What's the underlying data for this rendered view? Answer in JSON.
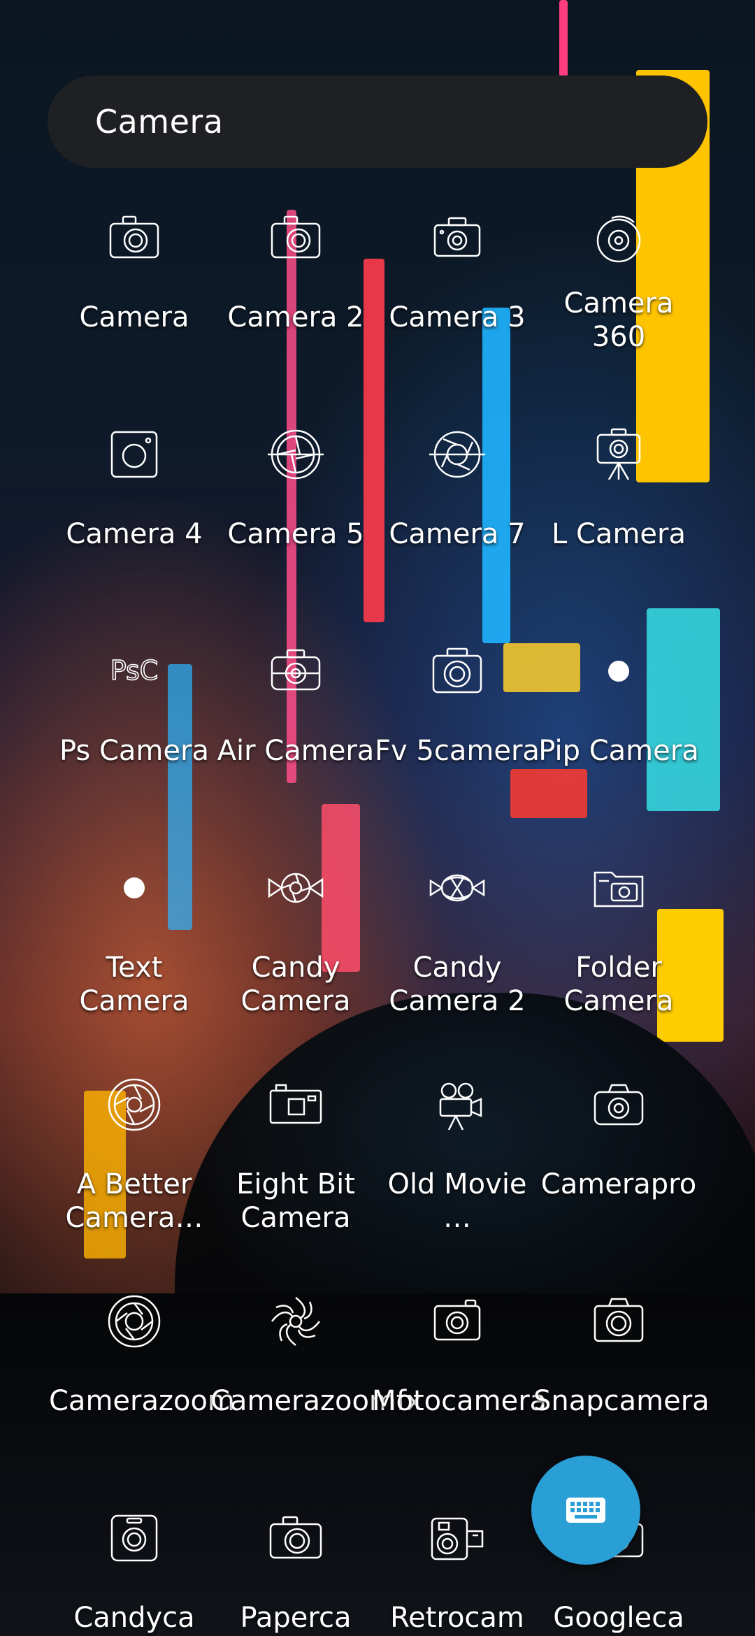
{
  "search": {
    "query": "Camera"
  },
  "apps": [
    {
      "label": "Camera",
      "icon": "camera-icon"
    },
    {
      "label": "Camera 2",
      "icon": "camera-icon"
    },
    {
      "label": "Camera 3",
      "icon": "camera-icon"
    },
    {
      "label": "Camera 360",
      "icon": "camera-360-icon"
    },
    {
      "label": "Camera 4",
      "icon": "camera-square-icon"
    },
    {
      "label": "Camera 5",
      "icon": "aperture-icon"
    },
    {
      "label": "Camera 7",
      "icon": "aperture-icon"
    },
    {
      "label": "L Camera",
      "icon": "camera-tripod-icon"
    },
    {
      "label": "Ps Camera",
      "icon": "psc-logo-icon"
    },
    {
      "label": "Air Camera",
      "icon": "camera-icon"
    },
    {
      "label": "Fv 5camera",
      "icon": "camera-icon"
    },
    {
      "label": "Pip Camera",
      "icon": "dot-icon"
    },
    {
      "label": "Text Camera",
      "icon": "dot-icon"
    },
    {
      "label": "Candy Camera",
      "icon": "candy-icon"
    },
    {
      "label": "Candy Camera 2",
      "icon": "candy-icon"
    },
    {
      "label": "Folder Camera",
      "icon": "folder-camera-icon"
    },
    {
      "label": "A Better Camera…",
      "icon": "aperture-icon"
    },
    {
      "label": "Eight Bit Camera",
      "icon": "camera-icon"
    },
    {
      "label": "Old Movie …",
      "icon": "movie-camera-icon"
    },
    {
      "label": "Camerapro",
      "icon": "camera-icon"
    },
    {
      "label": "Camerazoom",
      "icon": "aperture-icon"
    },
    {
      "label": "Camerazoomfx",
      "icon": "shutter-icon"
    },
    {
      "label": "Motocamera",
      "icon": "camera-icon"
    },
    {
      "label": "Snapcamera",
      "icon": "camera-icon"
    },
    {
      "label": "Candyca",
      "icon": "camera-icon"
    },
    {
      "label": "Paperca",
      "icon": "camera-icon"
    },
    {
      "label": "Retrocam",
      "icon": "retro-camera-icon"
    },
    {
      "label": "Googleca",
      "icon": "camera-icon"
    }
  ],
  "fab": {
    "icon": "keyboard-icon"
  },
  "colors": {
    "searchBar": "#1e2023",
    "fab": "#2a9fd6",
    "text": "#ffffff"
  }
}
